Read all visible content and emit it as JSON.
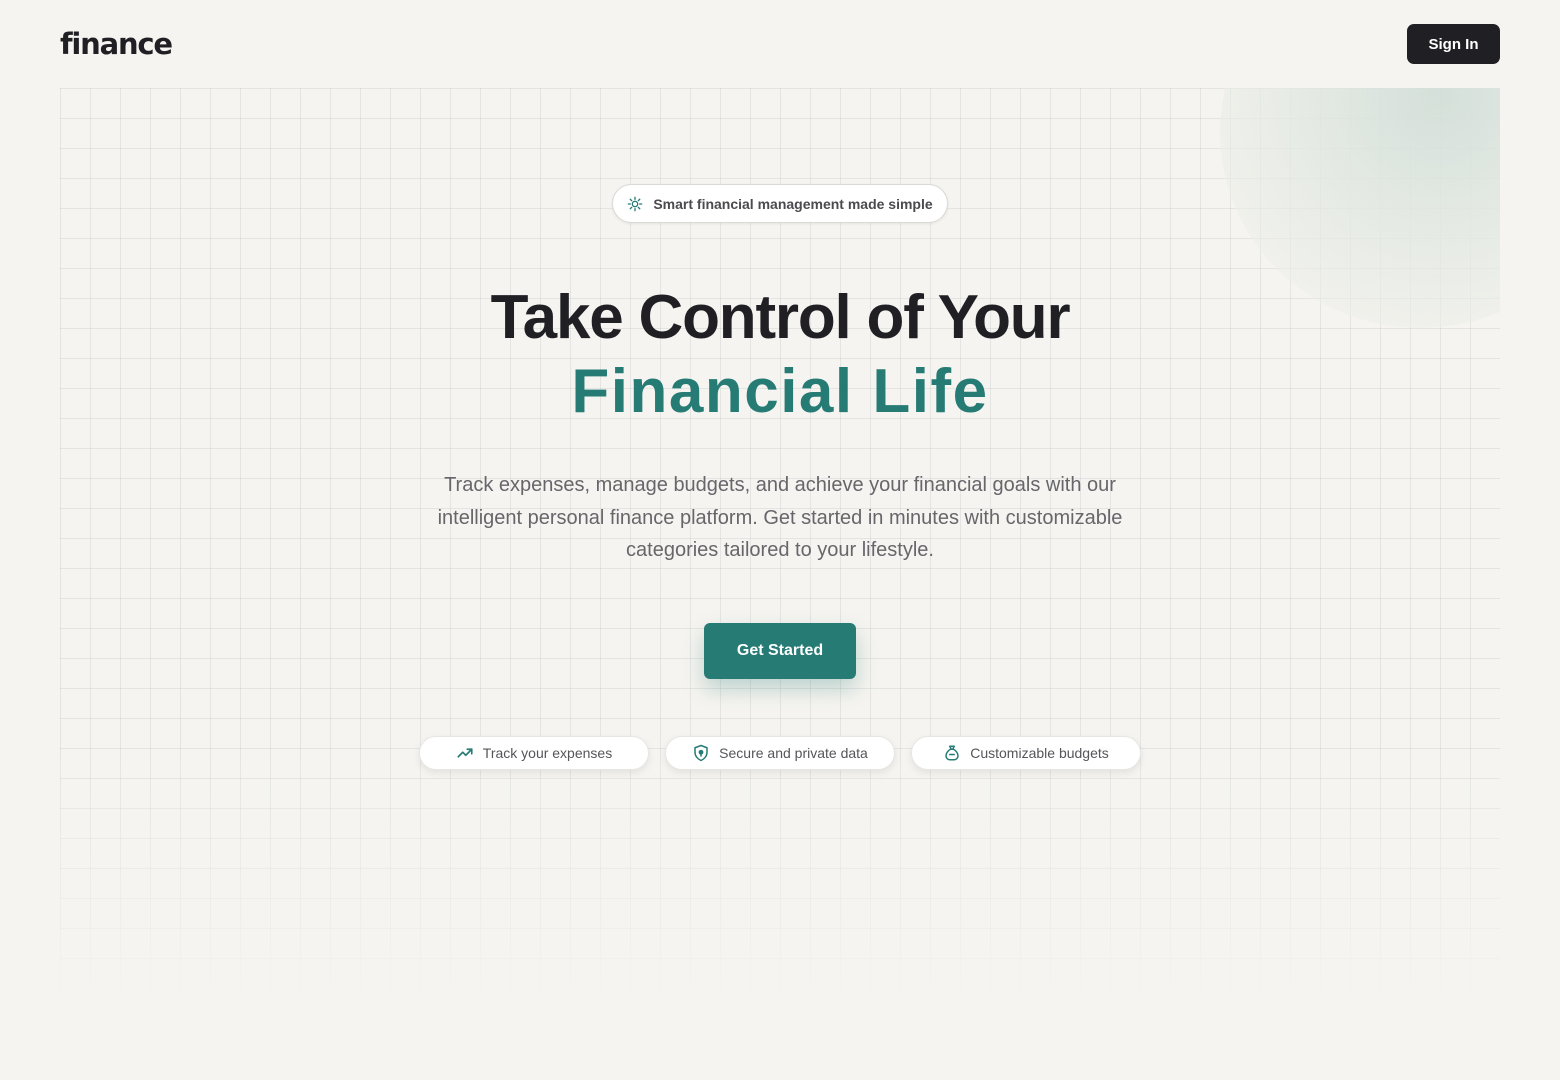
{
  "header": {
    "logo": "finance",
    "sign_in_label": "Sign In"
  },
  "hero": {
    "badge": {
      "icon": "sparkle-icon",
      "text": "Smart financial management made simple"
    },
    "title_line_1": "Take Control of Your",
    "title_line_2": "Financial Life",
    "description": "Track expenses, manage budgets, and achieve your financial goals with our intelligent personal finance platform. Get started in minutes with customizable categories tailored to your lifestyle.",
    "cta_label": "Get Started"
  },
  "features": [
    {
      "icon": "trending-up-icon",
      "label": "Track your expenses"
    },
    {
      "icon": "shield-icon",
      "label": "Secure and private data"
    },
    {
      "icon": "money-bag-icon",
      "label": "Customizable budgets"
    }
  ],
  "colors": {
    "background": "#f6f4f0",
    "text_dark": "#1f1f24",
    "accent": "#267b75",
    "muted_text": "#66666b"
  }
}
